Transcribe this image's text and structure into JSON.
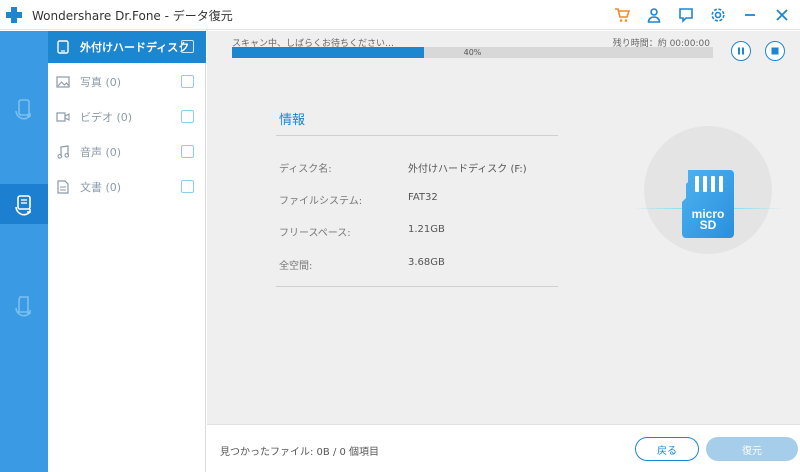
{
  "window": {
    "title": "Wondershare Dr.Fone - データ復元",
    "icons": [
      "cart-icon",
      "user-icon",
      "feedback-icon",
      "settings-icon",
      "minimize-icon",
      "close-icon"
    ]
  },
  "rail": {
    "items": [
      {
        "icon": "phone-recover-icon"
      },
      {
        "icon": "drive-recover-icon"
      },
      {
        "icon": "sd-recover-icon"
      }
    ]
  },
  "categories": [
    {
      "label": "外付けハードディスク …",
      "icon": "drive-icon"
    },
    {
      "label": "写真 (0)",
      "icon": "photo-icon"
    },
    {
      "label": "ビデオ (0)",
      "icon": "video-icon"
    },
    {
      "label": "音声 (0)",
      "icon": "music-icon"
    },
    {
      "label": "文書 (0)",
      "icon": "document-icon"
    }
  ],
  "scan": {
    "status": "スキャン中、しばらくお待ちください…",
    "remaining": "残り時間：約 00:00:00",
    "progress_label": "40%",
    "progress": 0.4
  },
  "info": {
    "title": "情報",
    "rows": [
      {
        "label": "ディスク名:",
        "value": "外付けハードディスク (F:)"
      },
      {
        "label": "ファイルシステム:",
        "value": "FAT32"
      },
      {
        "label": "フリースペース:",
        "value": "1.21GB"
      },
      {
        "label": "全空間:",
        "value": "3.68GB"
      }
    ],
    "card_label": "micro SD"
  },
  "footer": {
    "found": "見つかったファイル: 0B / 0 個項目",
    "back_label": "戻る",
    "recover_label": "復元"
  },
  "colors": {
    "accent": "#1d86d1",
    "rail": "#3a9ae3",
    "cart": "#f08a24"
  }
}
